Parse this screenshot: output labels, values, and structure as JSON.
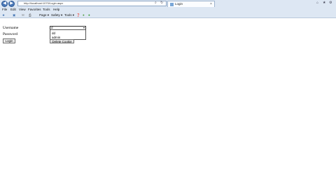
{
  "browser": {
    "address_url": "http://localhost:1070/Login.aspx",
    "tab_title": "Login",
    "menu": [
      "File",
      "Edit",
      "View",
      "Favorites",
      "Tools",
      "Help"
    ],
    "commands": {
      "page": "Page ▾",
      "safety": "Safety ▾",
      "tools": "Tools ▾"
    }
  },
  "form": {
    "username_label": "Username",
    "password_label": "Password",
    "username_selected": "d",
    "dropdown_options": [
      "dd",
      "admin"
    ],
    "login_button": "Login",
    "delete_cookie_button": "Delete Cookie"
  }
}
